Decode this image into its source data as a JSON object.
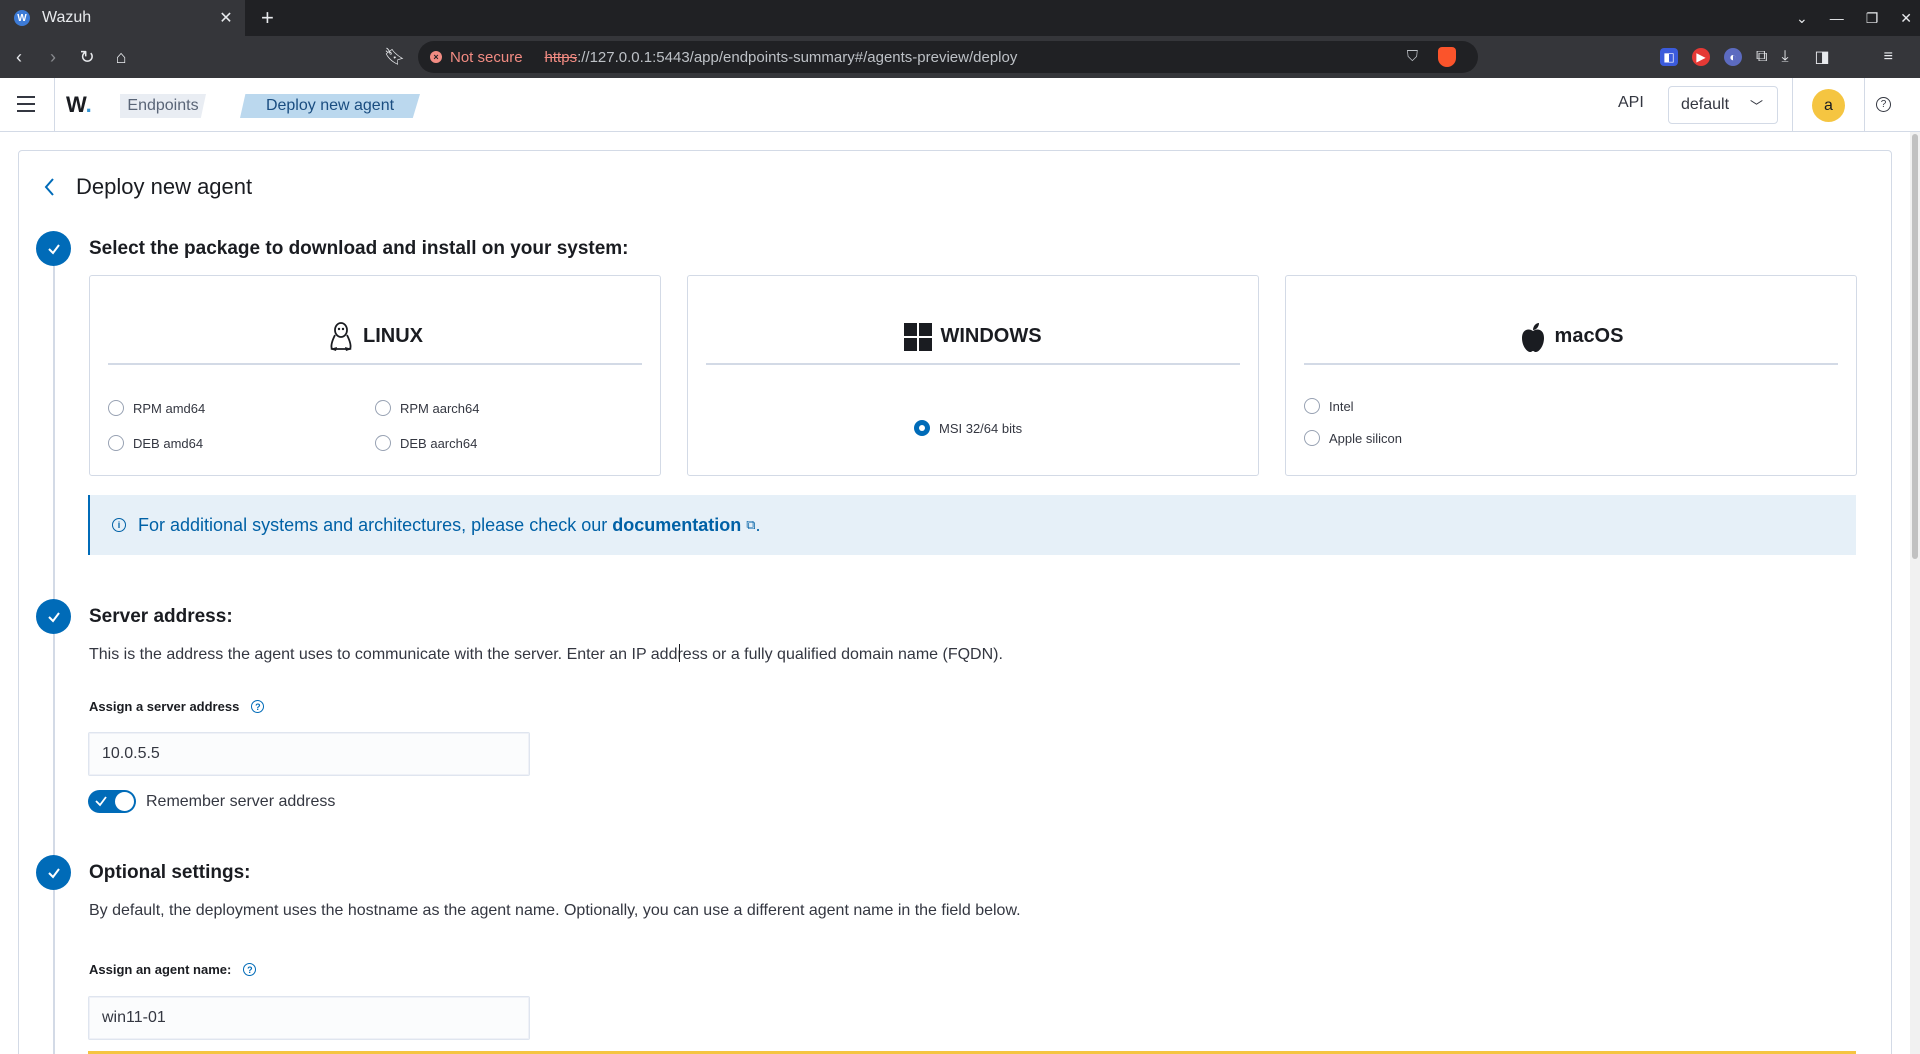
{
  "browser": {
    "tab_title": "Wazuh",
    "tab_favicon": "W",
    "not_secure": "Not secure",
    "url_scheme": "https",
    "url_rest": "://127.0.0.1:5443/app/endpoints-summary#/agents-preview/deploy"
  },
  "header": {
    "logo_text": "W",
    "logo_dot": ".",
    "breadcrumb": [
      "Endpoints",
      "Deploy new agent"
    ],
    "api_label": "API",
    "api_selected": "default",
    "avatar_letter": "a"
  },
  "page": {
    "title": "Deploy new agent",
    "steps": {
      "package": {
        "title": "Select the package to download and install on your system:",
        "os": [
          {
            "name": "LINUX",
            "options": [
              "RPM amd64",
              "RPM aarch64",
              "DEB amd64",
              "DEB aarch64"
            ]
          },
          {
            "name": "WINDOWS",
            "options": [
              "MSI 32/64 bits"
            ],
            "selected": "MSI 32/64 bits"
          },
          {
            "name": "macOS",
            "options": [
              "Intel",
              "Apple silicon"
            ]
          }
        ],
        "callout_text": "For additional systems and architectures, please check our",
        "callout_link": "documentation",
        "callout_end": "."
      },
      "server": {
        "title": "Server address:",
        "description": "This is the address the agent uses to communicate with the server. Enter an IP address or a fully qualified domain name (FQDN).",
        "field_label": "Assign a server address",
        "field_value": "10.0.5.5",
        "toggle_label": "Remember server address",
        "toggle_on": true
      },
      "optional": {
        "title": "Optional settings:",
        "description": "By default, the deployment uses the hostname as the agent name. Optionally, you can use a different agent name in the field below.",
        "field_label": "Assign an agent name:",
        "field_value": "win11-01"
      }
    }
  },
  "colors": {
    "primary": "#006bb8",
    "callout_bg": "#e6f0f8",
    "avatar": "#f5c541"
  }
}
